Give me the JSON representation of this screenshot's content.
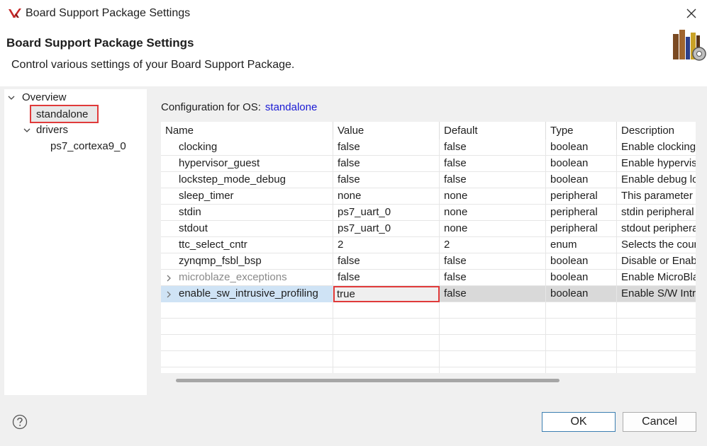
{
  "window": {
    "title": "Board Support Package Settings"
  },
  "header": {
    "title": "Board Support Package Settings",
    "description": "Control various settings of your Board Support Package."
  },
  "tree": {
    "items": [
      {
        "label": "Overview",
        "expanded": true
      },
      {
        "label": "standalone",
        "selected": true
      },
      {
        "label": "drivers",
        "expanded": true
      },
      {
        "label": "ps7_cortexa9_0"
      }
    ]
  },
  "config": {
    "label": "Configuration for OS:",
    "os": "standalone"
  },
  "table": {
    "columns": [
      "Name",
      "Value",
      "Default",
      "Type",
      "Description"
    ],
    "rows": [
      {
        "name": "clocking",
        "value": "false",
        "default": "false",
        "type": "boolean",
        "description": "Enable clocking support"
      },
      {
        "name": "hypervisor_guest",
        "value": "false",
        "default": "false",
        "type": "boolean",
        "description": "Enable hypervisor guest support"
      },
      {
        "name": "lockstep_mode_debug",
        "value": "false",
        "default": "false",
        "type": "boolean",
        "description": "Enable debug logic"
      },
      {
        "name": "sleep_timer",
        "value": "none",
        "default": "none",
        "type": "peripheral",
        "description": "This parameter is used"
      },
      {
        "name": "stdin",
        "value": "ps7_uart_0",
        "default": "none",
        "type": "peripheral",
        "description": "stdin peripheral"
      },
      {
        "name": "stdout",
        "value": "ps7_uart_0",
        "default": "none",
        "type": "peripheral",
        "description": "stdout peripheral"
      },
      {
        "name": "ttc_select_cntr",
        "value": "2",
        "default": "2",
        "type": "enum",
        "description": "Selects the counter"
      },
      {
        "name": "zynqmp_fsbl_bsp",
        "value": "false",
        "default": "false",
        "type": "boolean",
        "description": "Disable or Enable"
      },
      {
        "name": "microblaze_exceptions",
        "value": "false",
        "default": "false",
        "type": "boolean",
        "description": "Enable MicroBlaze"
      },
      {
        "name": "enable_sw_intrusive_profiling",
        "value": "true",
        "default": "false",
        "type": "boolean",
        "description": "Enable S/W Intrusive"
      }
    ]
  },
  "buttons": {
    "ok": "OK",
    "cancel": "Cancel"
  },
  "colors": {
    "accent_red": "#e03a3a",
    "link_blue": "#1a1ad4",
    "ok_border": "#3c7fb1"
  },
  "icons": {
    "app": "xilinx-logo-icon",
    "close": "close-icon",
    "help": "help-icon",
    "header": "bsp-books-gear-icon"
  }
}
